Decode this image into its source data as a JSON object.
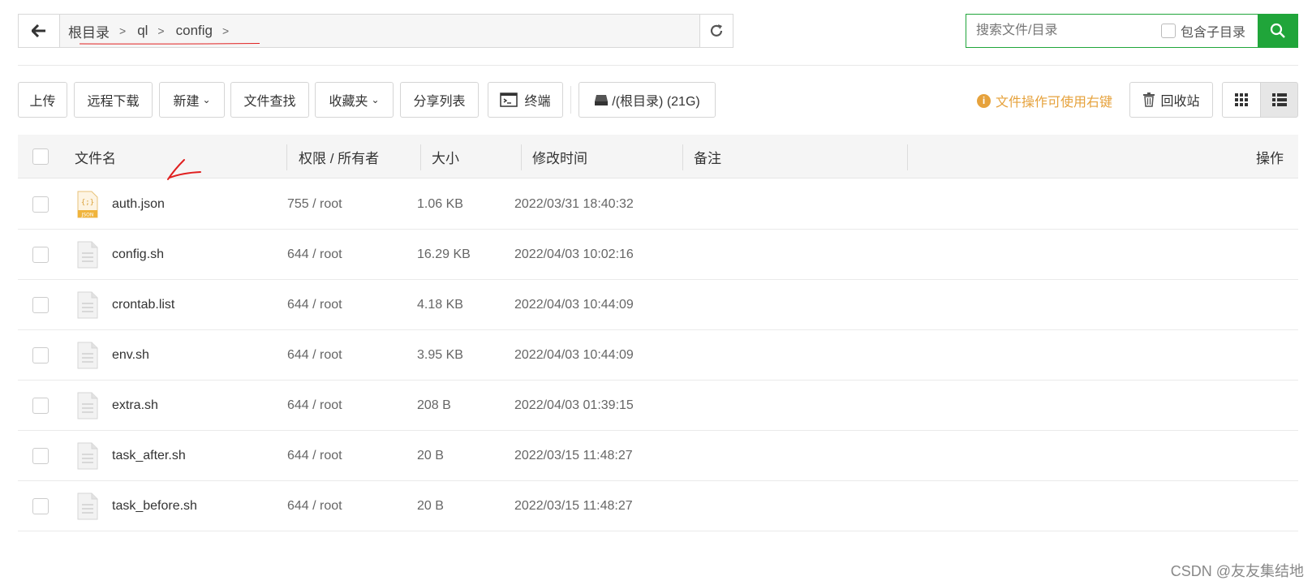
{
  "path": {
    "crumbs": [
      "根目录",
      "ql",
      "config"
    ]
  },
  "search": {
    "placeholder": "搜索文件/目录",
    "subdir_label": "包含子目录"
  },
  "toolbar": {
    "upload": "上传",
    "remote_download": "远程下载",
    "new": "新建",
    "file_search": "文件查找",
    "favorites": "收藏夹",
    "share_list": "分享列表",
    "terminal": "终端",
    "disk": "/(根目录) (21G)",
    "hint": "文件操作可使用右键",
    "recycle": "回收站"
  },
  "table": {
    "headers": {
      "name": "文件名",
      "perm": "权限 / 所有者",
      "size": "大小",
      "mtime": "修改时间",
      "note": "备注",
      "action": "操作"
    },
    "rows": [
      {
        "name": "auth.json",
        "perm": "755 / root",
        "size": "1.06 KB",
        "mtime": "2022/03/31 18:40:32",
        "icon": "json-file-icon"
      },
      {
        "name": "config.sh",
        "perm": "644 / root",
        "size": "16.29 KB",
        "mtime": "2022/04/03 10:02:16",
        "icon": "text-file-icon"
      },
      {
        "name": "crontab.list",
        "perm": "644 / root",
        "size": "4.18 KB",
        "mtime": "2022/04/03 10:44:09",
        "icon": "text-file-icon"
      },
      {
        "name": "env.sh",
        "perm": "644 / root",
        "size": "3.95 KB",
        "mtime": "2022/04/03 10:44:09",
        "icon": "text-file-icon"
      },
      {
        "name": "extra.sh",
        "perm": "644 / root",
        "size": "208 B",
        "mtime": "2022/04/03 01:39:15",
        "icon": "text-file-icon"
      },
      {
        "name": "task_after.sh",
        "perm": "644 / root",
        "size": "20 B",
        "mtime": "2022/03/15 11:48:27",
        "icon": "text-file-icon"
      },
      {
        "name": "task_before.sh",
        "perm": "644 / root",
        "size": "20 B",
        "mtime": "2022/03/15 11:48:27",
        "icon": "text-file-icon"
      }
    ]
  },
  "json_icon_label": "JSON",
  "watermark": "CSDN @友友集结地",
  "colors": {
    "accent": "#20a53a",
    "hint": "#e6a23c",
    "annotation": "#e02020"
  }
}
